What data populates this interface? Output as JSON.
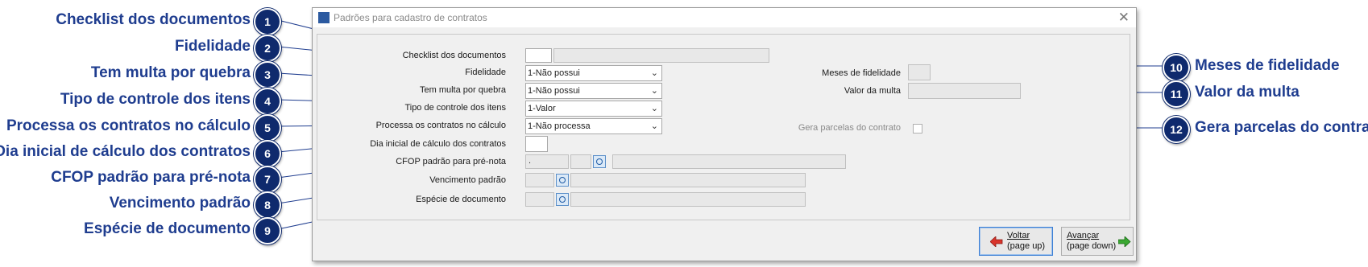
{
  "callouts": {
    "c1": {
      "num": "1",
      "label": "Checklist dos documentos"
    },
    "c2": {
      "num": "2",
      "label": "Fidelidade"
    },
    "c3": {
      "num": "3",
      "label": "Tem multa por quebra"
    },
    "c4": {
      "num": "4",
      "label": "Tipo de controle dos itens"
    },
    "c5": {
      "num": "5",
      "label": "Processa os contratos no cálculo"
    },
    "c6": {
      "num": "6",
      "label": "Dia inicial de cálculo dos contratos"
    },
    "c7": {
      "num": "7",
      "label": "CFOP padrão para pré-nota"
    },
    "c8": {
      "num": "8",
      "label": "Vencimento padrão"
    },
    "c9": {
      "num": "9",
      "label": "Espécie de documento"
    },
    "c10": {
      "num": "10",
      "label": "Meses de fidelidade"
    },
    "c11": {
      "num": "11",
      "label": "Valor da multa"
    },
    "c12": {
      "num": "12",
      "label": "Gera parcelas do contrato"
    }
  },
  "window": {
    "title": "Padrões para cadastro de contratos",
    "close_glyph": "✕"
  },
  "form": {
    "checklist_label": "Checklist dos documentos",
    "fidelidade_label": "Fidelidade",
    "fidelidade_value": "1-Não possui",
    "multa_label": "Tem multa por quebra",
    "multa_value": "1-Não possui",
    "tipo_label": "Tipo de controle dos itens",
    "tipo_value": "1-Valor",
    "processa_label": "Processa os contratos no cálculo",
    "processa_value": "1-Não processa",
    "dia_label": "Dia inicial de cálculo dos contratos",
    "cfop_label": "CFOP padrão para pré-nota",
    "cfop_value": ".",
    "vencimento_label": "Vencimento padrão",
    "especie_label": "Espécie de documento",
    "meses_label": "Meses de fidelidade",
    "valor_multa_label": "Valor da multa",
    "gera_parcelas_label": "Gera parcelas do contrato",
    "dropdown_glyph": "⌄"
  },
  "buttons": {
    "voltar": {
      "line1": "Voltar",
      "line2": "(page up)"
    },
    "avancar": {
      "line1": "Avançar",
      "line2": "(page down)"
    }
  },
  "colors": {
    "callout_text": "#1f3d8f",
    "badge": "#0f2a6d",
    "window_bg": "#f0f0f0",
    "arrow_back": "#d9342b",
    "arrow_fwd": "#3aa832"
  }
}
